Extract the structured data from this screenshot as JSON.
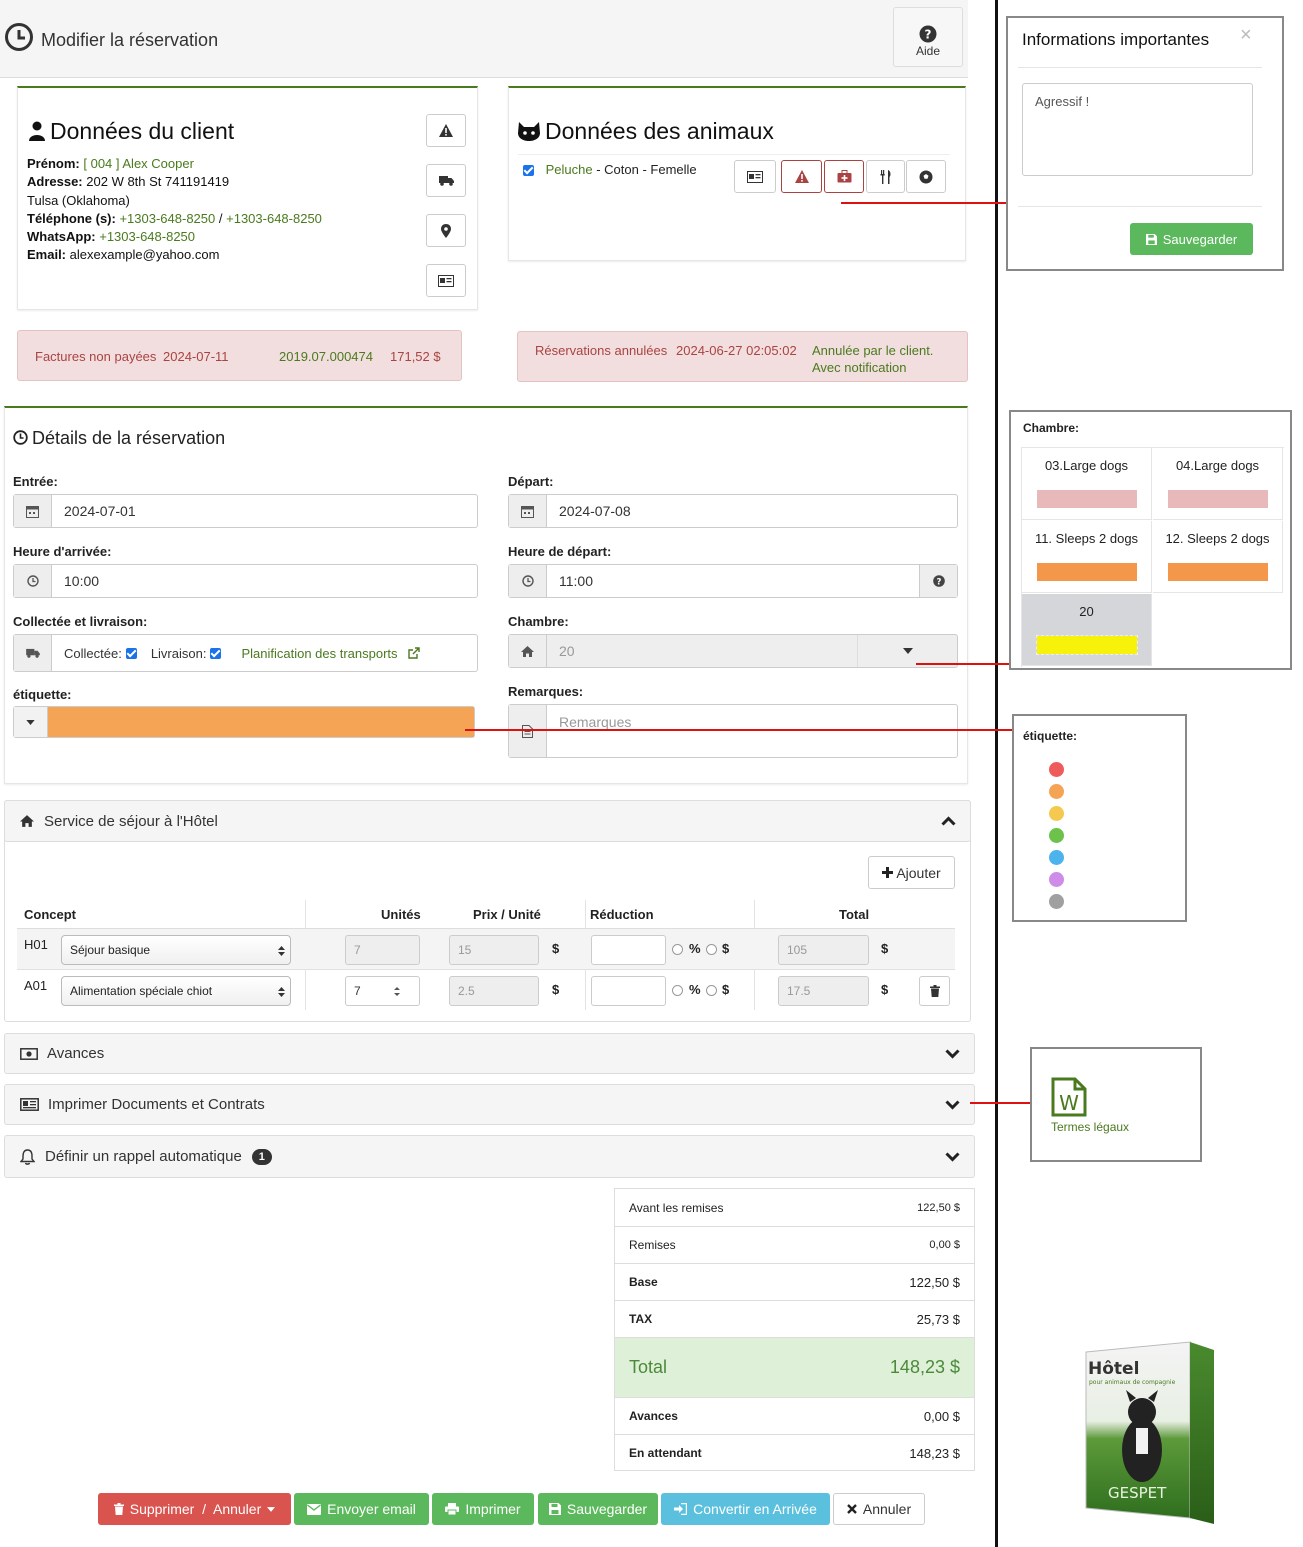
{
  "header": {
    "title": "Modifier la réservation",
    "help_label": "Aide"
  },
  "client": {
    "title": "Données du client",
    "prenom_label": "Prénom:",
    "prenom_value": "[ 004 ] Alex Cooper",
    "adresse_label": "Adresse:",
    "adresse_value": "202 W 8th St   741191419",
    "city": "Tulsa (Oklahoma)",
    "tel_label": "Téléphone (s):",
    "tel1": "+1303-648-8250",
    "tel_sep": "/",
    "tel2": "+1303-648-8250",
    "whatsapp_label": "WhatsApp:",
    "whatsapp_value": "+1303-648-8250",
    "email_label": "Email:",
    "email_value": "alexexample@yahoo.com"
  },
  "animals": {
    "title": "Données des animaux",
    "pet_name": "Peluche",
    "pet_details": " - Coton - Femelle"
  },
  "alerts": {
    "unpaid": {
      "label": "Factures non payées",
      "date": "2024-07-11",
      "ref": "2019.07.000474",
      "amount": "171,52 $"
    },
    "cancelled": {
      "label": "Réservations annulées",
      "date": "2024-06-27 02:05:02",
      "note1": "Annulée par le client.",
      "note2": "Avec notification"
    }
  },
  "details": {
    "title": "Détails de la réservation",
    "entree_label": "Entrée:",
    "entree_value": "2024-07-01",
    "depart_label": "Départ:",
    "depart_value": "2024-07-08",
    "heure_arrivee_label": "Heure d'arrivée:",
    "heure_arrivee_value": "10:00",
    "heure_depart_label": "Heure de départ:",
    "heure_depart_value": "11:00",
    "collecte_label": "Collectée et livraison:",
    "collectee": "Collectée:",
    "livraison": "Livraison:",
    "transport_link": "Planification des transports",
    "chambre_label": "Chambre:",
    "chambre_value": "20",
    "etiquette_label": "étiquette:",
    "etiquette_color": "#f5a455",
    "remarques_label": "Remarques:",
    "remarques_placeholder": "Remarques"
  },
  "service": {
    "title": "Service de séjour à l'Hôtel",
    "add_label": "Ajouter",
    "columns": {
      "concept": "Concept",
      "units": "Unités",
      "price": "Prix / Unité",
      "discount": "Réduction",
      "total": "Total"
    },
    "rows": [
      {
        "code": "H01",
        "concept": "Séjour basique",
        "units": "7",
        "price": "15",
        "currency": "$",
        "pct": "%",
        "dol": "$",
        "total": "105",
        "total_cur": "$"
      },
      {
        "code": "A01",
        "concept": "Alimentation spéciale chiot",
        "units": "7",
        "price": "2.5",
        "currency": "$",
        "pct": "%",
        "dol": "$",
        "total": "17.5",
        "total_cur": "$"
      }
    ]
  },
  "accordions": {
    "avances": "Avances",
    "imprimer": "Imprimer Documents et Contrats",
    "rappel": "Définir un rappel automatique",
    "rappel_badge": "1"
  },
  "summary": {
    "avant_label": "Avant les remises",
    "avant_value": "122,50 $",
    "remises_label": "Remises",
    "remises_value": "0,00 $",
    "base_label": "Base",
    "base_value": "122,50 $",
    "tax_label": "TAX",
    "tax_value": "25,73 $",
    "total_label": "Total",
    "total_value": "148,23 $",
    "avances_label": "Avances",
    "avances_value": "0,00 $",
    "attente_label": "En attendant",
    "attente_value": "148,23 $"
  },
  "footer": {
    "supprimer": "Supprimer  /  Annuler",
    "email": "Envoyer email",
    "imprimer": "Imprimer",
    "sauvegarder": "Sauvegarder",
    "convertir": "Convertir en Arrivée",
    "annuler": "Annuler"
  },
  "info_modal": {
    "title": "Informations importantes",
    "close": "×",
    "text": "Agressif !",
    "save_label": "Sauvegarder"
  },
  "room_popup": {
    "title": "Chambre:",
    "rooms": [
      {
        "name": "03.Large dogs",
        "color": "#e8b9bb"
      },
      {
        "name": "04.Large dogs",
        "color": "#e8b9bb"
      },
      {
        "name": "11. Sleeps 2 dogs",
        "color": "#f5974a"
      },
      {
        "name": "12. Sleeps 2 dogs",
        "color": "#f5974a"
      },
      {
        "name": "20",
        "color": "#f7f20a"
      }
    ]
  },
  "tag_popup": {
    "title": "étiquette:",
    "colors": [
      "#ef5b5b",
      "#f5a455",
      "#f5c94f",
      "#6cc24a",
      "#4db3ec",
      "#cf8be8",
      "#a0a0a0"
    ]
  },
  "doc_popup": {
    "label": "Termes légaux"
  },
  "product": {
    "title": "Hôtel",
    "subtitle": "pour animaux de compagnie",
    "brand": "GESPET"
  }
}
